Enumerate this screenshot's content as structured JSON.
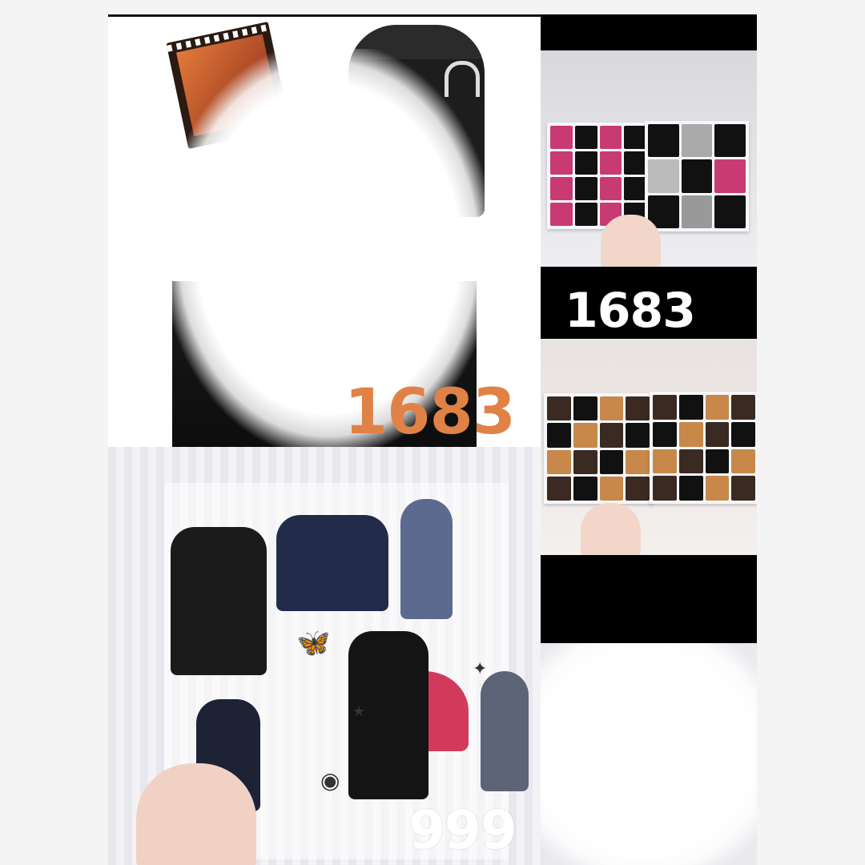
{
  "prices": {
    "top_left": "1683",
    "right_top": "1683",
    "bottom_left": "999"
  },
  "colors": {
    "page_bg": "#f4f4f4",
    "price_orange": "#e08245",
    "price_white": "#ffffff",
    "strip_black": "#000000",
    "heart_red": "#d23a5b"
  },
  "icons": {
    "film_strip": "film-strip-icon",
    "headphones": "headphones-icon",
    "butterfly": "butterfly-icon",
    "star": "star-icon",
    "vinyl": "vinyl-record-icon"
  }
}
